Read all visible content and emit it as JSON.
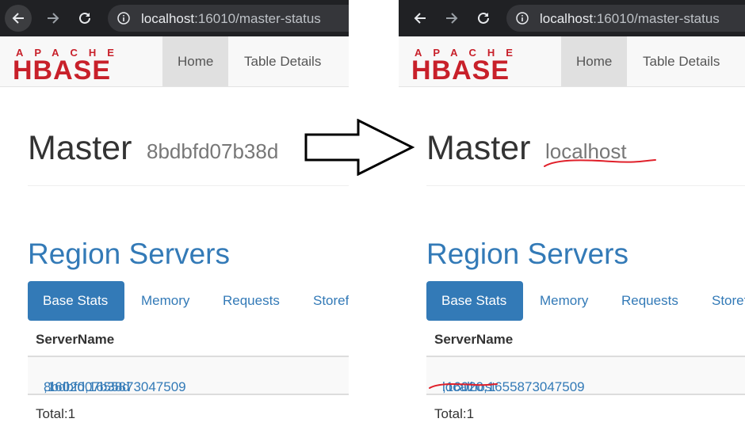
{
  "browser": {
    "url_host": "localhost",
    "url_path": ":16010/master-status"
  },
  "navbar": {
    "logo_top": "APACHE",
    "logo_bottom": "HBASE",
    "home_label": "Home",
    "table_details_label": "Table Details"
  },
  "before": {
    "title": "Master",
    "hostname": "8bdbfd07b38d",
    "server_host": "8bdbfd07b38d",
    "server_suffix": ",16020,1655873047509"
  },
  "after": {
    "title": "Master",
    "hostname": "localhost",
    "server_host": "localhost",
    "server_suffix": ",16020,1655873047509"
  },
  "region_servers": {
    "heading": "Region Servers",
    "tabs": [
      "Base Stats",
      "Memory",
      "Requests",
      "Storefiles"
    ],
    "column_header": "ServerName",
    "total": "Total:1"
  },
  "colors": {
    "link": "#337ab7",
    "chrome_bg": "#202124",
    "annotation_red": "#e0202a",
    "logo_red": "#c8202a"
  }
}
